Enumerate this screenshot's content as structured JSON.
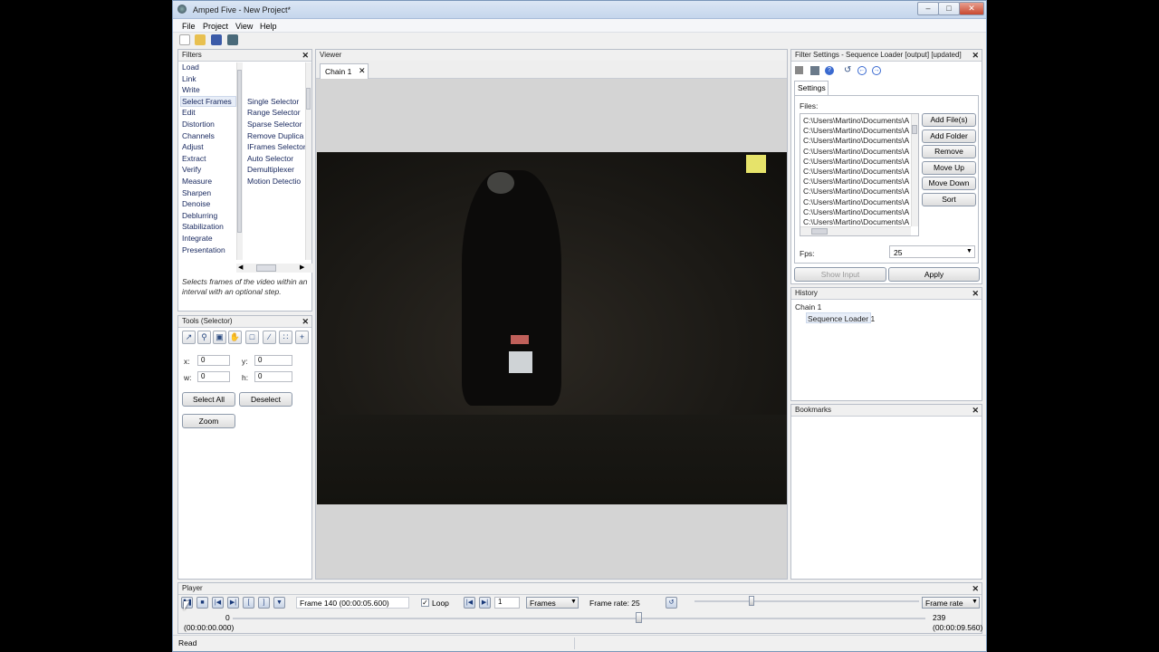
{
  "window": {
    "title": "Amped Five - New Project*"
  },
  "menu": [
    "File",
    "Project",
    "View",
    "Help"
  ],
  "filters_panel": {
    "title": "Filters",
    "categories": [
      "Load",
      "Link",
      "Write",
      "Select Frames",
      "Edit",
      "Distortion",
      "Channels",
      "Adjust",
      "Extract",
      "Verify",
      "Measure",
      "Sharpen",
      "Denoise",
      "Deblurring",
      "Stabilization",
      "Integrate",
      "Presentation"
    ],
    "selected_category": "Select Frames",
    "faded_top": [
      "",
      "",
      ""
    ],
    "items": [
      "Single Selector",
      "Range Selector",
      "Sparse Selector",
      "Remove Duplica",
      "IFrames Selector",
      "Auto Selector",
      "Demultiplexer",
      "Motion Detectio"
    ],
    "faded_bottom": [
      "",
      "",
      "",
      "",
      "",
      "",
      ""
    ],
    "description": "Selects frames of the video within an interval with an optional step."
  },
  "tools_panel": {
    "title": "Tools (Selector)",
    "x_label": "x:",
    "x_value": "0",
    "y_label": "y:",
    "y_value": "0",
    "w_label": "w:",
    "w_value": "0",
    "h_label": "h:",
    "h_value": "0",
    "select_all": "Select All",
    "deselect": "Deselect",
    "zoom": "Zoom"
  },
  "viewer": {
    "title": "Viewer",
    "tab": "Chain 1"
  },
  "filter_settings": {
    "title": "Filter Settings - Sequence Loader [output] [updated]",
    "tab": "Settings",
    "files_label": "Files:",
    "files": [
      "C:\\Users\\Martino\\Documents\\A",
      "C:\\Users\\Martino\\Documents\\A",
      "C:\\Users\\Martino\\Documents\\A",
      "C:\\Users\\Martino\\Documents\\A",
      "C:\\Users\\Martino\\Documents\\A",
      "C:\\Users\\Martino\\Documents\\A",
      "C:\\Users\\Martino\\Documents\\A",
      "C:\\Users\\Martino\\Documents\\A",
      "C:\\Users\\Martino\\Documents\\A",
      "C:\\Users\\Martino\\Documents\\A",
      "C:\\Users\\Martino\\Documents\\A"
    ],
    "buttons": [
      "Add File(s)",
      "Add Folder",
      "Remove",
      "Move Up",
      "Move Down",
      "Sort"
    ],
    "fps_label": "Fps:",
    "fps_value": "25",
    "show_input": "Show Input",
    "apply": "Apply"
  },
  "history": {
    "title": "History",
    "root": "Chain 1",
    "child": "Sequence Loader 1"
  },
  "bookmarks": {
    "title": "Bookmarks"
  },
  "player": {
    "title": "Player",
    "frame_display": "Frame 140 (00:00:05.600)",
    "loop_label": "Loop",
    "step_value": "1",
    "step_unit": "Frames",
    "frame_rate_text": "Frame rate: 25",
    "rate_mode": "Frame rate",
    "start_frame": "0",
    "start_time": "(00:00:00.000)",
    "end_frame": "239",
    "end_time": "(00:00:09.560)",
    "position_fraction": 0.585
  },
  "status": {
    "text": "Read"
  },
  "colors": {
    "accent": "#3c7fd0",
    "panel_border": "#b8bec8",
    "video_bg": "#1a1814"
  }
}
